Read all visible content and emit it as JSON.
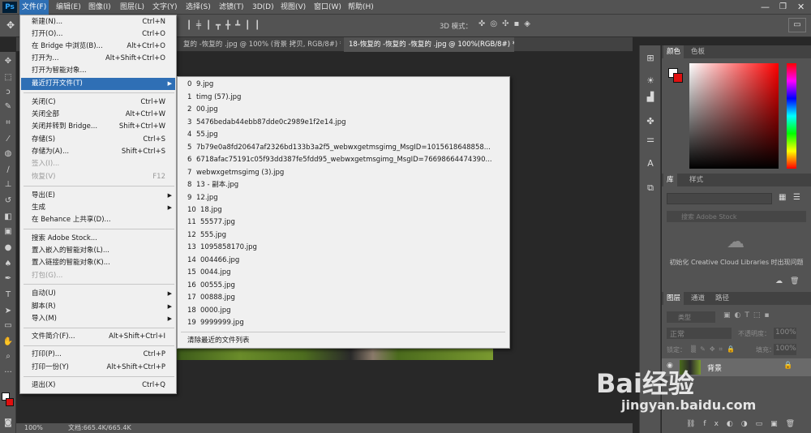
{
  "app_logo": "Ps",
  "menubar": [
    "文件(F)",
    "编辑(E)",
    "图像(I)",
    "图层(L)",
    "文字(Y)",
    "选择(S)",
    "滤镜(T)",
    "3D(D)",
    "视图(V)",
    "窗口(W)",
    "帮助(H)"
  ],
  "options_bar": {
    "mode_label": "3D 模式："
  },
  "tabs": [
    "复的 -恢复的 .jpg @ 100% (背景 拷贝, RGB/8#) *",
    "18-恢复的 -恢复的 -恢复的 .jpg @ 100%(RGB/8#) *"
  ],
  "file_menu": [
    {
      "label": "新建(N)...",
      "shortcut": "Ctrl+N"
    },
    {
      "label": "打开(O)...",
      "shortcut": "Ctrl+O"
    },
    {
      "label": "在 Bridge 中浏览(B)...",
      "shortcut": "Alt+Ctrl+O"
    },
    {
      "label": "打开为...",
      "shortcut": "Alt+Shift+Ctrl+O"
    },
    {
      "label": "打开为智能对象...",
      "shortcut": ""
    },
    {
      "label": "最近打开文件(T)",
      "shortcut": "",
      "submenu": true
    },
    {
      "label": "关闭(C)",
      "shortcut": "Ctrl+W"
    },
    {
      "label": "关闭全部",
      "shortcut": "Alt+Ctrl+W"
    },
    {
      "label": "关闭并转到 Bridge...",
      "shortcut": "Shift+Ctrl+W"
    },
    {
      "label": "存储(S)",
      "shortcut": "Ctrl+S"
    },
    {
      "label": "存储为(A)...",
      "shortcut": "Shift+Ctrl+S"
    },
    {
      "label": "签入(I)...",
      "shortcut": ""
    },
    {
      "label": "恢复(V)",
      "shortcut": "F12"
    },
    {
      "label": "导出(E)",
      "shortcut": "",
      "submenu": true
    },
    {
      "label": "生成",
      "shortcut": "",
      "submenu": true
    },
    {
      "label": "在 Behance 上共享(D)...",
      "shortcut": ""
    },
    {
      "label": "搜索 Adobe Stock...",
      "shortcut": ""
    },
    {
      "label": "置入嵌入的智能对象(L)...",
      "shortcut": ""
    },
    {
      "label": "置入链接的智能对象(K)...",
      "shortcut": ""
    },
    {
      "label": "打包(G)...",
      "shortcut": ""
    },
    {
      "label": "自动(U)",
      "shortcut": "",
      "submenu": true
    },
    {
      "label": "脚本(R)",
      "shortcut": "",
      "submenu": true
    },
    {
      "label": "导入(M)",
      "shortcut": "",
      "submenu": true
    },
    {
      "label": "文件简介(F)...",
      "shortcut": "Alt+Shift+Ctrl+I"
    },
    {
      "label": "打印(P)...",
      "shortcut": "Ctrl+P"
    },
    {
      "label": "打印一份(Y)",
      "shortcut": "Alt+Shift+Ctrl+P"
    },
    {
      "label": "退出(X)",
      "shortcut": "Ctrl+Q"
    }
  ],
  "recent_files": [
    {
      "num": "0",
      "name": "9.jpg"
    },
    {
      "num": "1",
      "name": "timg (57).jpg"
    },
    {
      "num": "2",
      "name": "00.jpg"
    },
    {
      "num": "3",
      "name": "5476bedab44ebb87dde0c2989e1f2e14.jpg"
    },
    {
      "num": "4",
      "name": "55.jpg"
    },
    {
      "num": "5",
      "name": "7b79e0a8fd20647af2326bd133b3a2f5_webwxgetmsgimg_MsgID=1015618648858..."
    },
    {
      "num": "6",
      "name": "6718afac75191c05f93dd387fe5fdd95_webwxgetmsgimg_MsgID=76698664474390..."
    },
    {
      "num": "7",
      "name": "webwxgetmsgimg (3).jpg"
    },
    {
      "num": "8",
      "name": "13 - 副本.jpg"
    },
    {
      "num": "9",
      "name": "12.jpg"
    },
    {
      "num": "10",
      "name": "18.jpg"
    },
    {
      "num": "11",
      "name": "55577.jpg"
    },
    {
      "num": "12",
      "name": "555.jpg"
    },
    {
      "num": "13",
      "name": "1095858170.jpg"
    },
    {
      "num": "14",
      "name": "004466.jpg"
    },
    {
      "num": "15",
      "name": "0044.jpg"
    },
    {
      "num": "16",
      "name": "00555.jpg"
    },
    {
      "num": "17",
      "name": "00888.jpg"
    },
    {
      "num": "18",
      "name": "0000.jpg"
    },
    {
      "num": "19",
      "name": "9999999.jpg"
    }
  ],
  "recent_clear": "清除最近的文件列表",
  "status": {
    "zoom": "100%",
    "doc": "文档:665.4K/665.4K"
  },
  "panels": {
    "color_tab": "颜色",
    "swatches_tab": "色板",
    "library_tab": "库",
    "styles_tab": "样式",
    "search_placeholder": "搜索 Adobe Stock",
    "cc_message": "初始化 Creative Cloud Libraries 时出现问题",
    "layers_tab": "图层",
    "channels_tab": "通道",
    "paths_tab": "路径",
    "kind_label": "类型",
    "blend_mode": "正常",
    "opacity_label": "不透明度：",
    "opacity_value": "100%",
    "lock_label": "锁定：",
    "fill_label": "填充：",
    "fill_value": "100%",
    "layer_name": "背景"
  },
  "watermark": {
    "brand": "Bai经验",
    "url": "jingyan.baidu.com"
  },
  "colors": {
    "menu_highlight": "#2f6fb5",
    "panel_bg": "#535353",
    "canvas_bg": "#282828"
  }
}
